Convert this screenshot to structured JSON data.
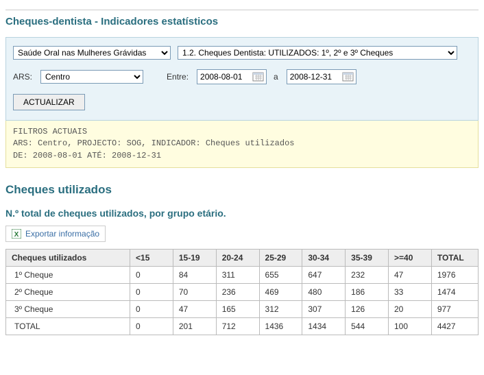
{
  "page_title": "Cheques-dentista - Indicadores estatísticos",
  "filters": {
    "project_select": "Saúde Oral nas Mulheres Grávidas",
    "indicator_select": "1.2. Cheques Dentista: UTILIZADOS: 1º, 2º e 3º Cheques",
    "ars_label": "ARS:",
    "ars_select": "Centro",
    "between_label": "Entre:",
    "date_from": "2008-08-01",
    "and_label": "a",
    "date_to": "2008-12-31",
    "update_button": "ACTUALIZAR"
  },
  "filters_current": {
    "line1": "FILTROS ACTUAIS",
    "line2": "ARS: Centro, PROJECTO: SOG, INDICADOR: Cheques utilizados",
    "line3": "DE: 2008-08-01 ATÉ: 2008-12-31"
  },
  "section_title": "Cheques utilizados",
  "subtitle": "N.º total de cheques utilizados, por grupo etário.",
  "export_label": "Exportar informação",
  "chart_data": {
    "type": "table",
    "corner_header": "Cheques utilizados",
    "columns": [
      "<15",
      "15-19",
      "20-24",
      "25-29",
      "30-34",
      "35-39",
      ">=40",
      "TOTAL"
    ],
    "rows": [
      {
        "label": "1º Cheque",
        "values": [
          "0",
          "84",
          "311",
          "655",
          "647",
          "232",
          "47",
          "1976"
        ]
      },
      {
        "label": "2º Cheque",
        "values": [
          "0",
          "70",
          "236",
          "469",
          "480",
          "186",
          "33",
          "1474"
        ]
      },
      {
        "label": "3º Cheque",
        "values": [
          "0",
          "47",
          "165",
          "312",
          "307",
          "126",
          "20",
          "977"
        ]
      },
      {
        "label": "TOTAL",
        "values": [
          "0",
          "201",
          "712",
          "1436",
          "1434",
          "544",
          "100",
          "4427"
        ]
      }
    ]
  }
}
